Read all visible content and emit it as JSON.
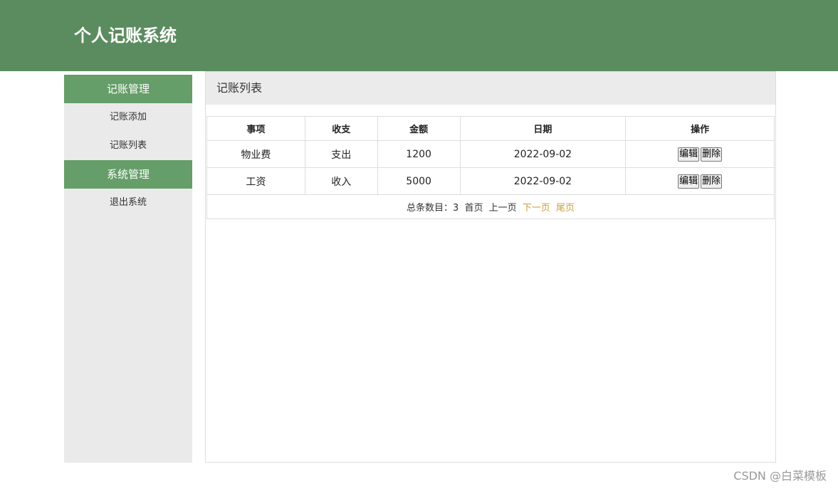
{
  "header": {
    "title": "个人记账系统"
  },
  "sidebar": {
    "groups": [
      {
        "label": "记账管理",
        "items": [
          {
            "label": "记账添加"
          },
          {
            "label": "记账列表"
          }
        ]
      },
      {
        "label": "系统管理",
        "items": [
          {
            "label": "退出系统"
          }
        ]
      }
    ]
  },
  "main": {
    "title": "记账列表",
    "table": {
      "columns": [
        "事项",
        "收支",
        "金额",
        "日期",
        "操作"
      ],
      "rows": [
        {
          "item": "物业费",
          "type": "支出",
          "amount": "1200",
          "date": "2022-09-02",
          "edit": "编辑",
          "delete": "删除"
        },
        {
          "item": "工资",
          "type": "收入",
          "amount": "5000",
          "date": "2022-09-02",
          "edit": "编辑",
          "delete": "删除"
        }
      ]
    },
    "pager": {
      "total_text": "总条数目：3",
      "first": "首页",
      "prev": "上一页",
      "next": "下一页",
      "last": "尾页"
    }
  },
  "colors": {
    "header": "#5b8c5f",
    "sidebar_group": "#659e68",
    "pager_link_active": "#c9a13a"
  },
  "watermark": "CSDN @白菜模板"
}
